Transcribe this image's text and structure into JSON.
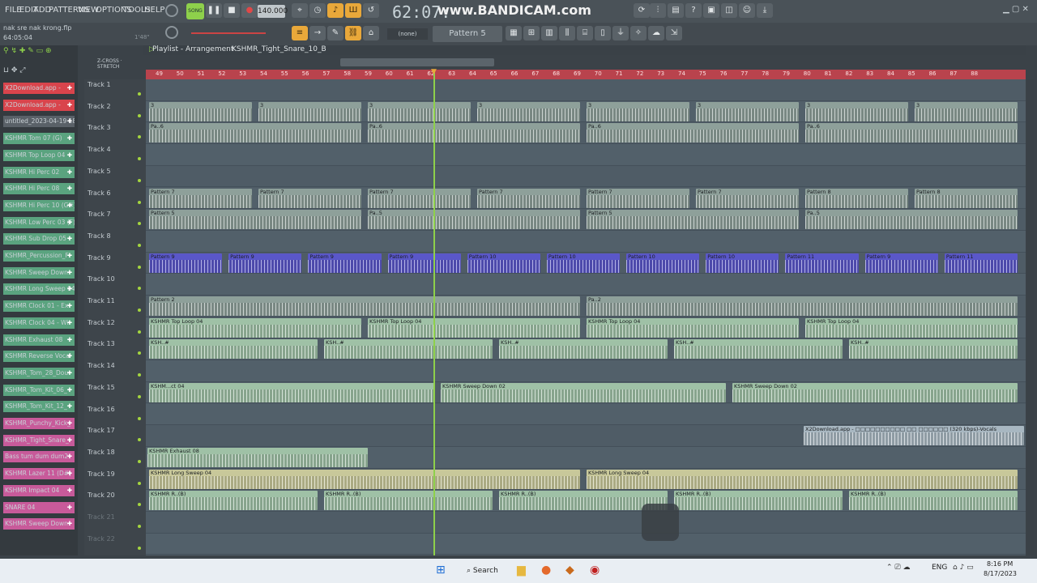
{
  "menu": [
    "FILE",
    "EDIT",
    "ADD",
    "PATTERNS",
    "VIEW",
    "OPTIONS",
    "TOOLS",
    "HELP"
  ],
  "transport": {
    "song_label": "SONG",
    "tempo": "140.000",
    "time": "62:07:",
    "pattern": "Pattern 5",
    "none_label": "(none)"
  },
  "watermark": "www.BANDICAM.com",
  "project": {
    "file": "nak sre nak krong.flp",
    "time": "64:05:04",
    "cpu": "1'48\""
  },
  "playlist": {
    "title": "Playlist - Arrangement",
    "crumb": "KSHMR_Tight_Snare_10_B"
  },
  "channels": [
    {
      "label": "X2Download.app -",
      "color": "#d9444c"
    },
    {
      "label": "X2Download.app -",
      "color": "#d9444c"
    },
    {
      "label": "untitled_2023-04-19 18-",
      "color": "#5a6168"
    },
    {
      "label": "KSHMR Tom 07 (G)",
      "color": "#5aa37f"
    },
    {
      "label": "KSHMR Top Loop 04",
      "color": "#5aa37f"
    },
    {
      "label": "KSHMR Hi Perc 02",
      "color": "#5aa37f"
    },
    {
      "label": "KSHMR Hi Perc 08",
      "color": "#5aa37f"
    },
    {
      "label": "KSHMR Hi Perc 10 (G#)",
      "color": "#5aa37f"
    },
    {
      "label": "KSHMR Low Perc 03 (F)",
      "color": "#5aa37f"
    },
    {
      "label": "KSHMR Sub Drop 05 -",
      "color": "#5aa37f"
    },
    {
      "label": "KSHMR_Percussion_F",
      "color": "#5aa37f"
    },
    {
      "label": "KSHMR Sweep Down",
      "color": "#5aa37f"
    },
    {
      "label": "KSHMR Long Sweep 04",
      "color": "#5aa37f"
    },
    {
      "label": "KSHMR Clock 01 - Ex",
      "color": "#5aa37f"
    },
    {
      "label": "KSHMR Clock 04 - Wi",
      "color": "#5aa37f"
    },
    {
      "label": "KSHMR Exhaust 08",
      "color": "#5aa37f"
    },
    {
      "label": "KSHMR Reverse Vocal",
      "color": "#5aa37f"
    },
    {
      "label": "KSHMR_Tom_28_Dou",
      "color": "#5aa37f"
    },
    {
      "label": "KSHMR_Tom_Kit_06_",
      "color": "#5aa37f"
    },
    {
      "label": "KSHMR_Tom_Kit_12_",
      "color": "#5aa37f"
    },
    {
      "label": "KSHMR_Punchy_Kick_",
      "color": "#c85a9a"
    },
    {
      "label": "KSHMR_Tight_Snare_",
      "color": "#c85a9a"
    },
    {
      "label": "Bass tum dum dum2",
      "color": "#c85a9a"
    },
    {
      "label": "KSHMR Lazer 11 (D#)",
      "color": "#c85a9a"
    },
    {
      "label": "KSHMR Impact 04",
      "color": "#c85a9a"
    },
    {
      "label": "SNARE 04",
      "color": "#c85a9a"
    },
    {
      "label": "KSHMR Sweep Down",
      "color": "#c85a9a"
    }
  ],
  "tracks": [
    "Track 1",
    "Track 2",
    "Track 3",
    "Track 4",
    "Track 5",
    "Track 6",
    "Track 7",
    "Track 8",
    "Track 9",
    "Track 10",
    "Track 11",
    "Track 12",
    "Track 13",
    "Track 14",
    "Track 15",
    "Track 16",
    "Track 17",
    "Track 18",
    "Track 19",
    "Track 20",
    "Track 21",
    "Track 22"
  ],
  "ruler": [
    "49",
    "50",
    "51",
    "52",
    "53",
    "54",
    "55",
    "56",
    "57",
    "58",
    "59",
    "60",
    "61",
    "62",
    "63",
    "64",
    "65",
    "66",
    "67",
    "68",
    "69",
    "70",
    "71",
    "72",
    "73",
    "74",
    "75",
    "76",
    "77",
    "78",
    "79",
    "80",
    "81",
    "82",
    "83",
    "84",
    "85",
    "86",
    "87",
    "88"
  ],
  "clips": [
    {
      "track": 2,
      "labels": [
        "3",
        "3",
        "3",
        "3",
        "3",
        "3",
        "3",
        "3"
      ],
      "color": "#8ea09a"
    },
    {
      "track": 3,
      "labels": [
        "Pa..6",
        "Pa..6",
        "Pa..6",
        "Pa..6"
      ],
      "color": "#8ea09a"
    },
    {
      "track": 6,
      "labels": [
        "Pattern 7",
        "Pattern 7",
        "Pattern 7",
        "Pattern 7",
        "Pattern 7",
        "Pattern 7",
        "Pattern 8",
        "Pattern 8"
      ],
      "color": "#8ea09a"
    },
    {
      "track": 7,
      "labels": [
        "Pattern 5",
        "Pa..5",
        "Pattern 5",
        "Pa..5"
      ],
      "color": "#8ea09a"
    },
    {
      "track": 9,
      "labels": [
        "Pattern 9",
        "Pattern 9",
        "Pattern 9",
        "Pattern 9",
        "Pattern 10",
        "Pattern 10",
        "Pattern 10",
        "Pattern 10",
        "Pattern 11",
        "Pattern 9",
        "Pattern 11"
      ],
      "color": "#5a57c9"
    },
    {
      "track": 11,
      "labels": [
        "Pattern 2",
        "Pa..2"
      ],
      "color": "#8ea09a"
    },
    {
      "track": 12,
      "labels": [
        "KSHMR Top Loop 04",
        "KSHMR Top Loop 04",
        "KSHMR Top Loop 04",
        "KSHMR Top Loop 04"
      ],
      "color": "#9fc1a6"
    },
    {
      "track": 13,
      "labels": [
        "KSH..#",
        "KSH..#",
        "KSH..#",
        "KSH..#",
        "KSH..#"
      ],
      "color": "#9fc1a6"
    },
    {
      "track": 15,
      "labels": [
        "KSHM...ct 04",
        "KSHMR Sweep Down 02",
        "KSHMR Sweep Down 02"
      ],
      "color": "#9fc1a6"
    },
    {
      "track": 17,
      "labels": [
        "X2Download.app - □□□□□□□□□□ □□ □□□□□□ (320 kbps)-Vocals"
      ],
      "color": "#a8b7c1"
    },
    {
      "track": 18,
      "labels": [
        "KSHMR Exhaust 08"
      ],
      "color": "#9fc1a6"
    },
    {
      "track": 19,
      "labels": [
        "KSHMR Long Sweep 04",
        "KSHMR Long Sweep 04"
      ],
      "color": "#c8c89a"
    },
    {
      "track": 20,
      "labels": [
        "KSHMR R..(B)",
        "KSHMR R..(B)",
        "KSHMR R..(B)",
        "KSHMR R..(B)",
        "KSHMR R..(B)"
      ],
      "color": "#9fc1a6"
    }
  ],
  "taskbar": {
    "search": "Search",
    "lang": "ENG",
    "time": "8:16 PM",
    "date": "8/17/2023"
  },
  "colors": {
    "ruler": "#b9434d",
    "playhead": "#8ed04b",
    "accent": "#e9a83a"
  }
}
